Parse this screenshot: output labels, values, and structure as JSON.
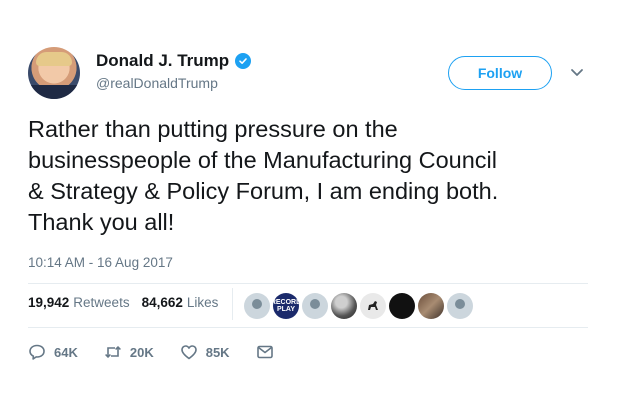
{
  "author": {
    "display_name": "Donald J. Trump",
    "handle": "@realDonaldTrump",
    "verified": true
  },
  "follow_button": {
    "label": "Follow"
  },
  "tweet": {
    "text": "Rather than putting pressure on the\nbusinesspeople of the Manufacturing Council\n& Strategy & Policy Forum, I am ending both.\nThank you all!",
    "timestamp": "10:14 AM - 16 Aug 2017"
  },
  "stats": {
    "retweets_count": "19,942",
    "retweets_label": "Retweets",
    "likes_count": "84,662",
    "likes_label": "Likes"
  },
  "likers": [
    {
      "kind": "default"
    },
    {
      "kind": "badge",
      "text": "RECORD\nPLAY"
    },
    {
      "kind": "default"
    },
    {
      "kind": "moon"
    },
    {
      "kind": "dog"
    },
    {
      "kind": "black"
    },
    {
      "kind": "photo"
    },
    {
      "kind": "default"
    }
  ],
  "actions": {
    "reply_count": "64K",
    "retweet_count": "20K",
    "like_count": "85K"
  },
  "colors": {
    "accent": "#1da1f2",
    "secondary_text": "#657786",
    "primary_text": "#14171a",
    "border": "#e6ecf0"
  },
  "icons": [
    "verified-badge-icon",
    "chevron-down-icon",
    "reply-icon",
    "retweet-icon",
    "heart-icon",
    "direct-message-icon"
  ]
}
